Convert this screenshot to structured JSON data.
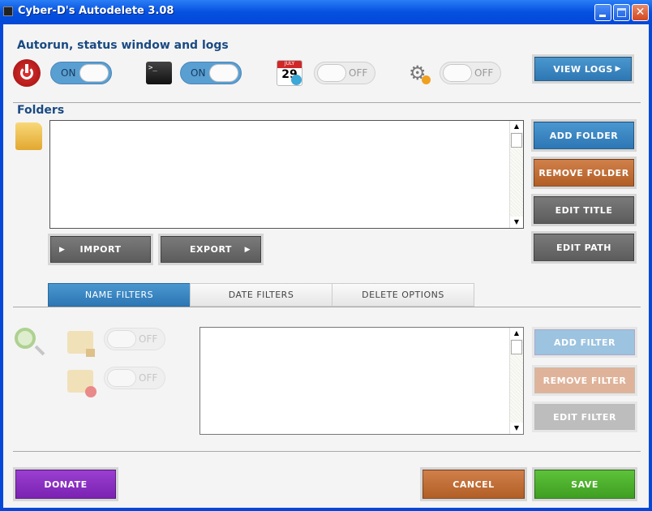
{
  "window": {
    "title": "Cyber-D's Autodelete 3.08",
    "close": "✕"
  },
  "autorun": {
    "heading": "Autorun, status window and logs",
    "toggles": [
      {
        "label": "ON",
        "state": "on"
      },
      {
        "label": "ON",
        "state": "on"
      },
      {
        "label": "OFF",
        "state": "off"
      },
      {
        "label": "OFF",
        "state": "off"
      }
    ],
    "calendar_day": "29",
    "calendar_month": "JULY",
    "view_logs": "VIEW LOGS"
  },
  "folders": {
    "heading": "Folders",
    "items": [],
    "add": "ADD FOLDER",
    "remove": "REMOVE FOLDER",
    "edit_title": "EDIT TITLE",
    "edit_path": "EDIT PATH",
    "import": "IMPORT",
    "export": "EXPORT"
  },
  "tabs": [
    {
      "label": "NAME FILTERS",
      "selected": true
    },
    {
      "label": "DATE FILTERS"
    },
    {
      "label": "DELETE OPTIONS"
    }
  ],
  "filters": {
    "toggles": [
      {
        "label": "OFF"
      },
      {
        "label": "OFF"
      }
    ],
    "items": [],
    "add": "ADD FILTER",
    "remove": "REMOVE FILTER",
    "edit": "EDIT FILTER"
  },
  "footer": {
    "donate": "DONATE",
    "cancel": "CANCEL",
    "save": "SAVE"
  },
  "colors": {
    "accent": "#3a86c0",
    "orange": "#c06a30",
    "green": "#4cae2e",
    "purple": "#8a2fc0"
  }
}
